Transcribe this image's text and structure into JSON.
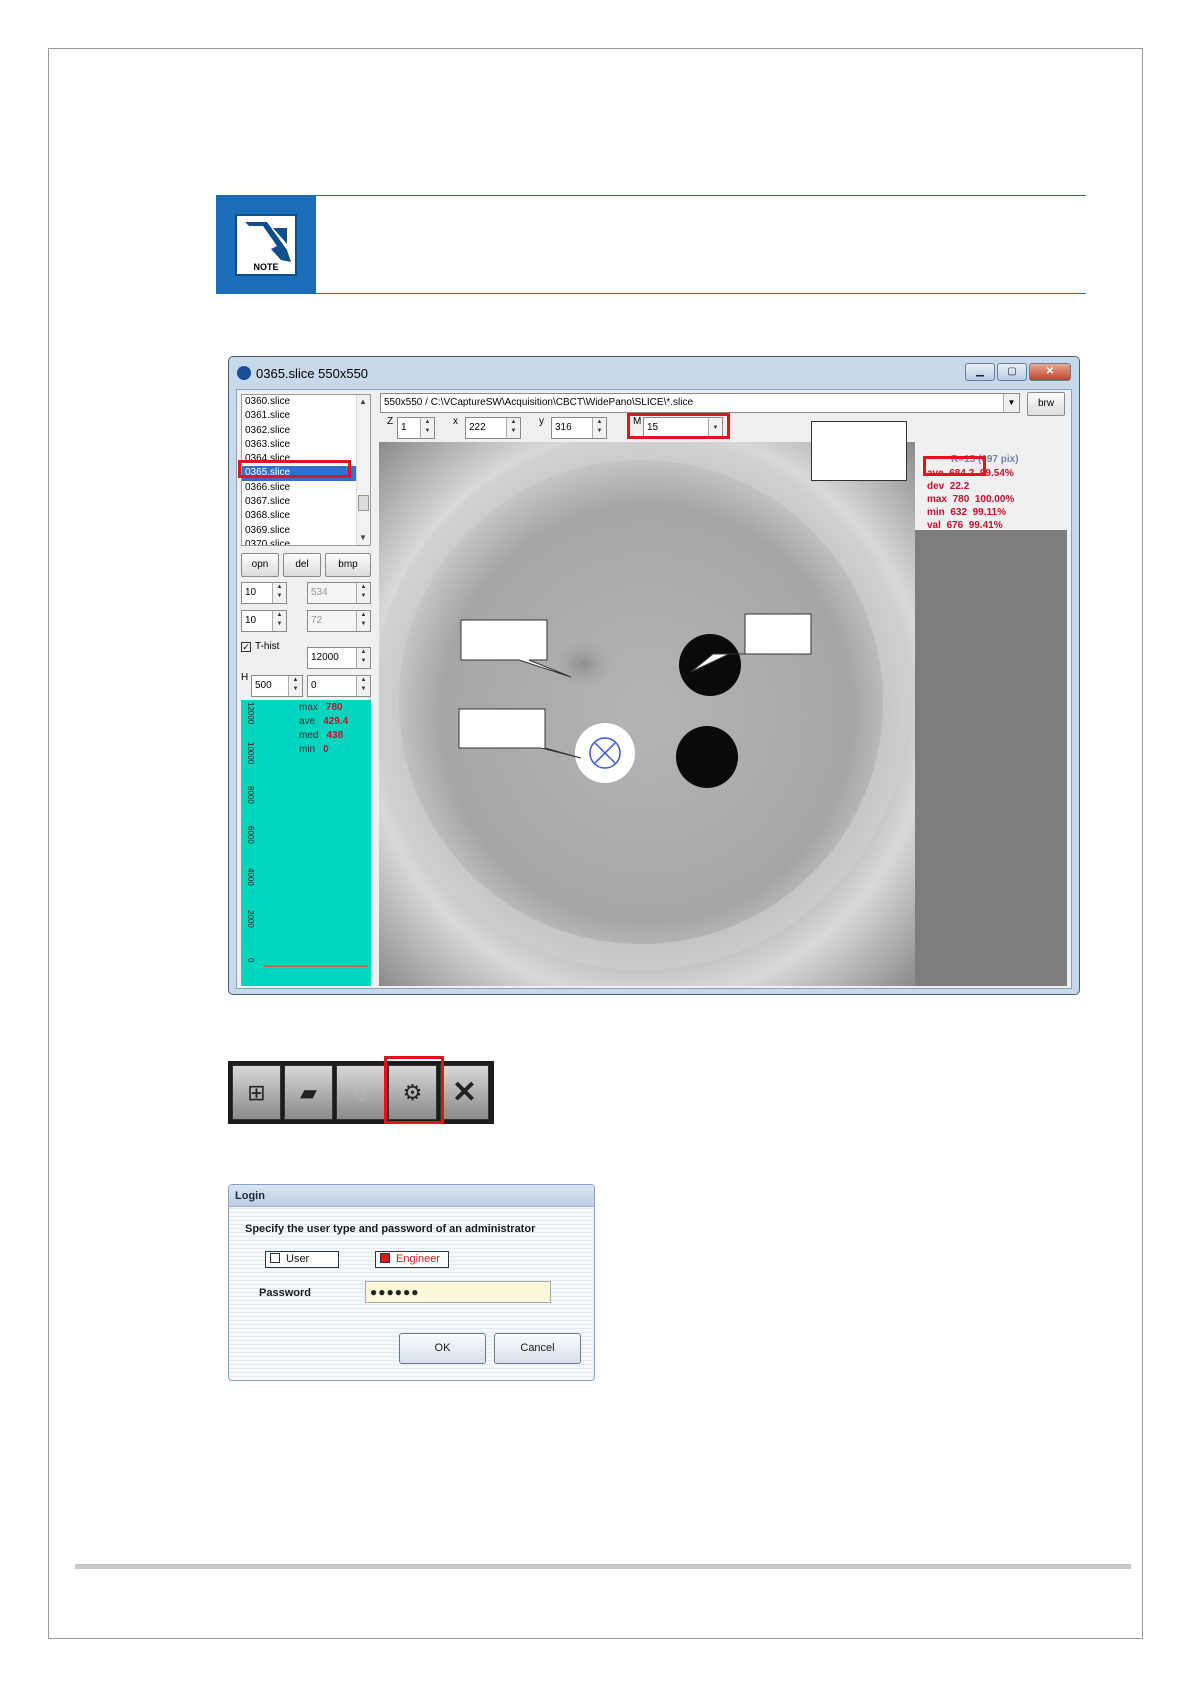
{
  "note": {
    "label": "NOTE"
  },
  "app": {
    "title": "0365.slice 550x550",
    "files": [
      "0360.slice",
      "0361.slice",
      "0362.slice",
      "0363.slice",
      "0364.slice",
      "0365.slice",
      "0366.slice",
      "0367.slice",
      "0368.slice",
      "0369.slice",
      "0370.slice"
    ],
    "selected_file": "0365.slice",
    "buttons": {
      "open": "opn",
      "delete": "del",
      "bitmap": "bmp",
      "browse": "brw"
    },
    "spinners": {
      "a1": "10",
      "a2": "534",
      "b1": "10",
      "b2": "72",
      "h": "500",
      "h2": "0",
      "t_value": "12000"
    },
    "t_hist_label": "T-hist",
    "h_label": "H",
    "path": "550x550 / C:\\VCaptureSW\\Acquisition\\CBCT\\WidePano\\SLICE\\*.slice",
    "controls": {
      "z_label": "Z",
      "z": "1",
      "x_label": "x",
      "x": "222",
      "y_label": "y",
      "y": "316",
      "m_label": "M",
      "m": "15"
    },
    "histogram": {
      "ticks": [
        "12000",
        "10000",
        "8000",
        "6000",
        "4000",
        "2000",
        "0"
      ],
      "stats": [
        {
          "key": "max",
          "value": "780"
        },
        {
          "key": "ave",
          "value": "429.4"
        },
        {
          "key": "med",
          "value": "438"
        },
        {
          "key": "min",
          "value": "0"
        }
      ]
    },
    "roi_stats": {
      "header": "R=15 (697 pix)",
      "rows": [
        {
          "key": "ave",
          "value": "684.2",
          "pct": "99.54%"
        },
        {
          "key": "dev",
          "value": "22.2",
          "pct": ""
        },
        {
          "key": "max",
          "value": "780",
          "pct": "100.00%"
        },
        {
          "key": "min",
          "value": "632",
          "pct": "99.11%"
        },
        {
          "key": "val",
          "value": "676",
          "pct": "99.41%"
        }
      ]
    }
  },
  "toolbar": {
    "icons": [
      "add-module-icon",
      "layers-icon",
      "lightbulb-icon",
      "gears-icon",
      "close-x-icon"
    ]
  },
  "login": {
    "title": "Login",
    "prompt": "Specify the user type and password of an administrator",
    "user_label": "User",
    "engineer_label": "Engineer",
    "password_label": "Password",
    "password_value": "●●●●●●",
    "ok": "OK",
    "cancel": "Cancel"
  }
}
